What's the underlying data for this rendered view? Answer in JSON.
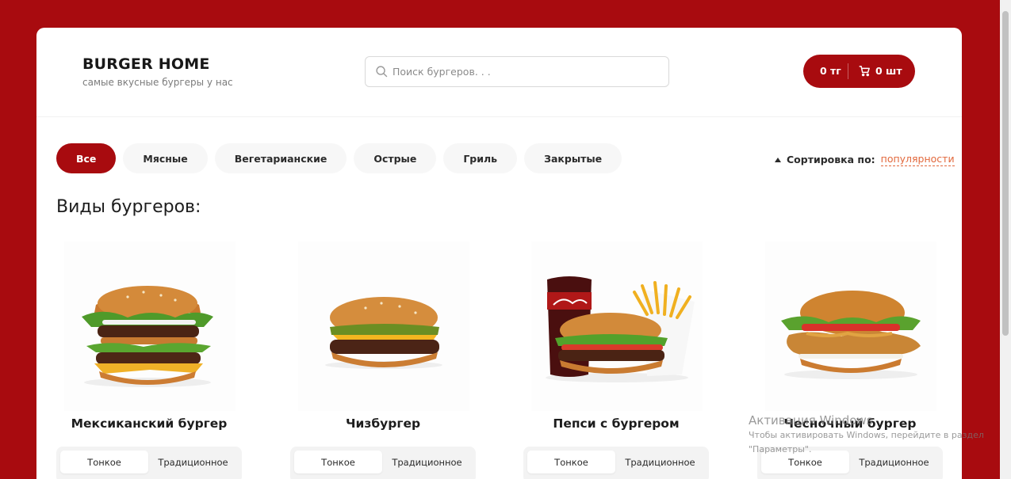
{
  "header": {
    "title": "BURGER HOME",
    "subtitle": "самые вкусные бургеры у нас"
  },
  "search": {
    "placeholder": "Поиск бургеров. . ."
  },
  "cart": {
    "price": "0 тг",
    "count": "0 шт"
  },
  "categories": [
    "Все",
    "Мясные",
    "Вегетарианские",
    "Острые",
    "Гриль",
    "Закрытые"
  ],
  "active_category": "Все",
  "sort": {
    "label": "Сортировка по:",
    "value": "популярности"
  },
  "section_title": "Виды бургеров:",
  "products": [
    {
      "name": "Мексиканский бургер",
      "dough": [
        "Тонкое",
        "Традиционное"
      ]
    },
    {
      "name": "Чизбургер",
      "dough": [
        "Тонкое",
        "Традиционное"
      ]
    },
    {
      "name": "Пепси с бургером",
      "dough": [
        "Тонкое",
        "Традиционное"
      ]
    },
    {
      "name": "Чесночный бургер",
      "dough": [
        "Тонкое",
        "Традиционное"
      ]
    }
  ],
  "watermark": {
    "title": "Активация Windows",
    "line1": "Чтобы активировать Windows, перейдите в раздел",
    "line2": "\"Параметры\"."
  },
  "colors": {
    "brand": "#a80b0f",
    "accent": "#e2683c"
  },
  "icons": [
    "search-icon",
    "cart-icon",
    "sort-arrow-icon"
  ]
}
